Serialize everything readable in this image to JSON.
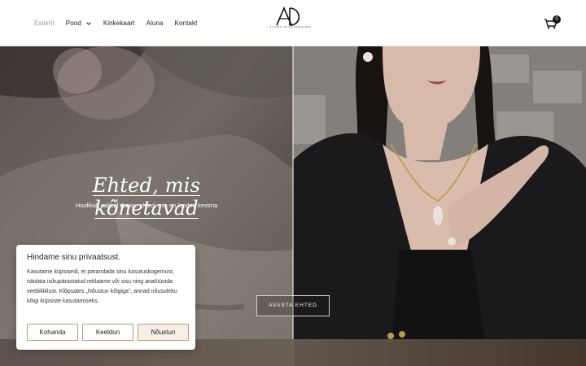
{
  "nav": {
    "items": [
      {
        "label": "Esileht",
        "active": true
      },
      {
        "label": "Pood",
        "dropdown": true
      },
      {
        "label": "Kinkekaart"
      },
      {
        "label": "Aluna"
      },
      {
        "label": "Kontakt"
      }
    ]
  },
  "logo": {
    "text": "ALUNA DISAINEHTED"
  },
  "cart": {
    "count": "0"
  },
  "hero": {
    "title": "Ehted, mis kõnetavad",
    "subtitle": "Hoolikalt valitud disain: ehted, mis on loodud kestma",
    "cta_label": "AVASTA EHTED"
  },
  "cookie": {
    "title": "Hindame sinu privaatsust.",
    "text": "Kasutame küpsiseid, et parandada sinu kasutuskogemust, näidata isikupärastatud reklaame või sisu ning analüüsida veebiliiklust. Klõpsates „Nõustun kõigiga\", annad nõusoleku kõigi küpsiste kasutamiseks.",
    "customize_label": "Kohanda",
    "reject_label": "Keeldun",
    "accept_label": "Nõustun"
  },
  "colors": {
    "accent_border": "#b89c78",
    "active_nav": "#9a9a9a",
    "header_bg": "#ffffff"
  }
}
